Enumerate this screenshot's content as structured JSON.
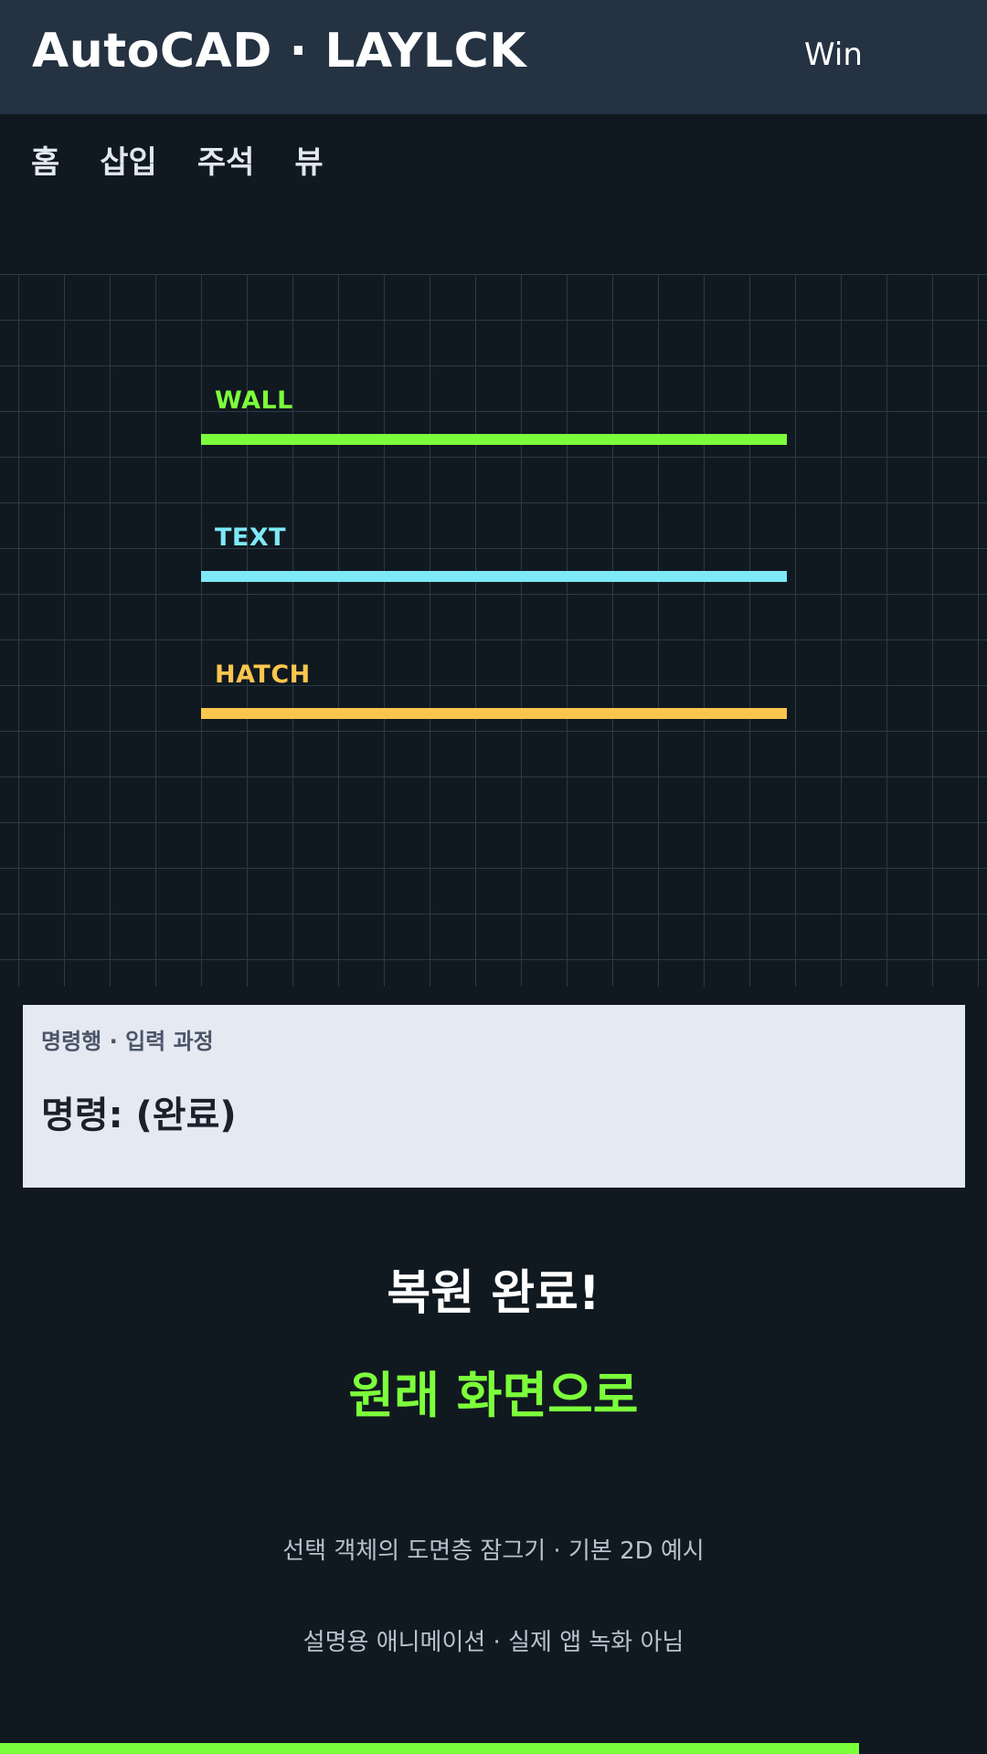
{
  "header": {
    "title": "AutoCAD · LAYLCK",
    "platform": "Win"
  },
  "ribbon": {
    "tabs": [
      "홈",
      "삽입",
      "주석",
      "뷰"
    ]
  },
  "canvas": {
    "layers": [
      {
        "name": "WALL",
        "color": "#7cff3b"
      },
      {
        "name": "TEXT",
        "color": "#7ee8f7"
      },
      {
        "name": "HATCH",
        "color": "#fbc64d"
      }
    ]
  },
  "command_line": {
    "heading": "명령행 · 입력 과정",
    "text": "명령: (완료)"
  },
  "status": {
    "title": "복원 완료!",
    "link": "원래 화면으로"
  },
  "captions": {
    "line1": "선택 객체의 도면층 잠그기 · 기본 2D 예시",
    "line2": "설명용 애니메이션 · 실제 앱 녹화 아님"
  },
  "colors": {
    "accent": "#7cff3b",
    "titlebar": "#243242",
    "background": "#111920"
  },
  "progress": {
    "fraction": 0.87
  }
}
